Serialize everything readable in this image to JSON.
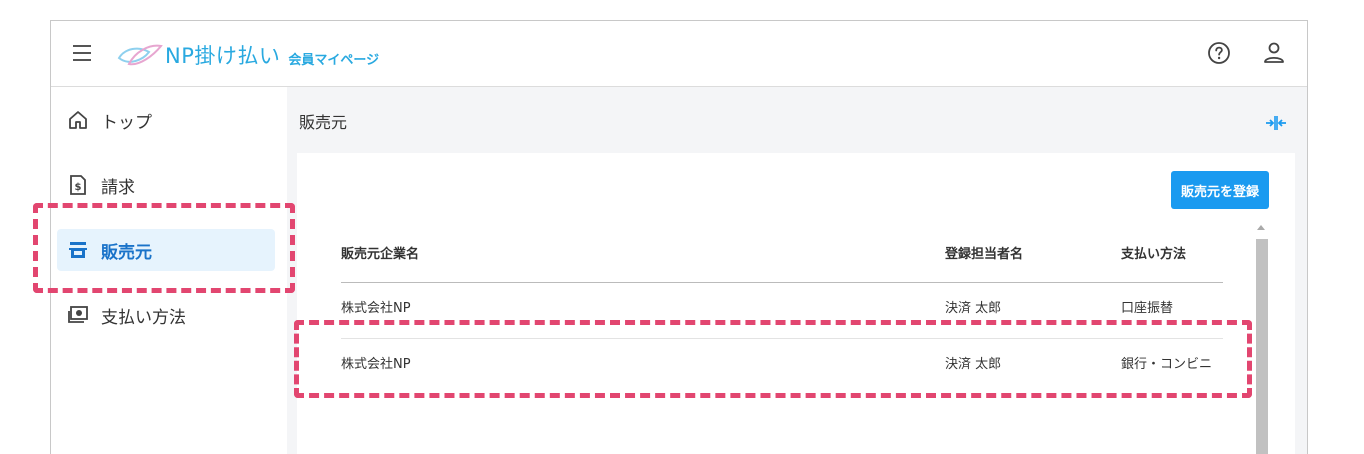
{
  "header": {
    "logo_text": "NP掛け払い",
    "logo_sub": "会員マイページ"
  },
  "sidebar": {
    "items": [
      {
        "label": "トップ",
        "icon": "home-icon",
        "active": false
      },
      {
        "label": "請求",
        "icon": "invoice-icon",
        "active": false
      },
      {
        "label": "販売元",
        "icon": "store-icon",
        "active": true
      },
      {
        "label": "支払い方法",
        "icon": "payment-icon",
        "active": false
      }
    ]
  },
  "main": {
    "title": "販売元",
    "register_button": "販売元を登録",
    "table": {
      "headers": [
        "販売元企業名",
        "登録担当者名",
        "支払い方法"
      ],
      "rows": [
        [
          "株式会社NP",
          "決済 太郎",
          "口座振替"
        ],
        [
          "株式会社NP",
          "決済 太郎",
          "銀行・コンビニ"
        ]
      ]
    }
  },
  "colors": {
    "brand": "#29a9e0",
    "accent": "#1a9af0",
    "active_bg": "#e6f3fd",
    "highlight": "#e24670"
  }
}
